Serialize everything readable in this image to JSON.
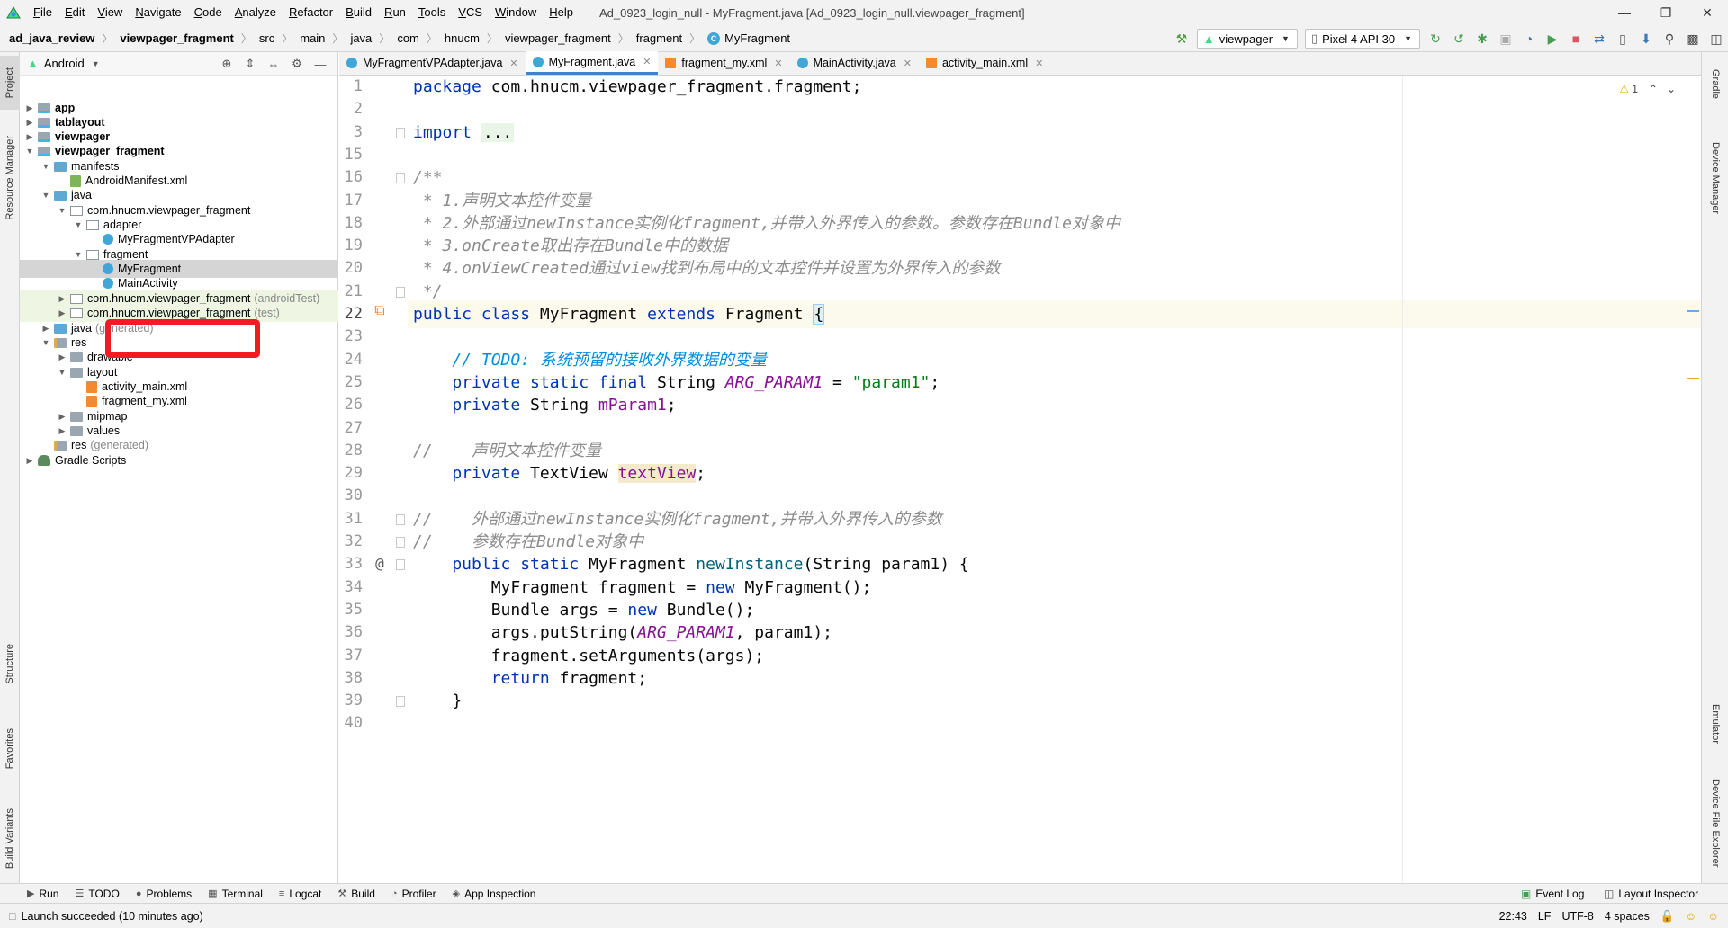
{
  "menubar": {
    "items": [
      "File",
      "Edit",
      "View",
      "Navigate",
      "Code",
      "Analyze",
      "Refactor",
      "Build",
      "Run",
      "Tools",
      "VCS",
      "Window",
      "Help"
    ],
    "window_title": "Ad_0923_login_null - MyFragment.java [Ad_0923_login_null.viewpager_fragment]"
  },
  "breadcrumb": [
    "ad_java_review",
    "viewpager_fragment",
    "src",
    "main",
    "java",
    "com",
    "hnucm",
    "viewpager_fragment",
    "fragment",
    "MyFragment"
  ],
  "toolbar": {
    "run_config": "viewpager",
    "device": "Pixel 4 API 30"
  },
  "left_stripe": [
    "Project",
    "Resource Manager",
    "Structure",
    "Favorites",
    "Build Variants"
  ],
  "right_stripe": [
    "Gradle",
    "Device Manager",
    "Emulator",
    "Device File Explorer"
  ],
  "project_panel": {
    "view_mode": "Android",
    "tree": [
      {
        "label": "app",
        "bold": true,
        "icon": "module",
        "arrow": "▶",
        "hint": ""
      },
      {
        "label": "tablayout",
        "bold": true,
        "icon": "module",
        "arrow": "▶",
        "hint": ""
      },
      {
        "label": "viewpager",
        "bold": true,
        "icon": "module",
        "arrow": "▶",
        "hint": ""
      },
      {
        "label": "viewpager_fragment",
        "bold": true,
        "icon": "module",
        "arrow": "▼",
        "hint": ""
      },
      {
        "label": "manifests",
        "bold": false,
        "icon": "src",
        "arrow": "▼",
        "hint": ""
      },
      {
        "label": "AndroidManifest.xml",
        "bold": false,
        "icon": "manifest",
        "arrow": "",
        "hint": ""
      },
      {
        "label": "java",
        "bold": false,
        "icon": "src",
        "arrow": "▼",
        "hint": ""
      },
      {
        "label": "com.hnucm.viewpager_fragment",
        "bold": false,
        "icon": "pkg",
        "arrow": "▼",
        "hint": ""
      },
      {
        "label": "adapter",
        "bold": false,
        "icon": "pkg",
        "arrow": "▼",
        "hint": ""
      },
      {
        "label": "MyFragmentVPAdapter",
        "bold": false,
        "icon": "cls",
        "arrow": "",
        "hint": ""
      },
      {
        "label": "fragment",
        "bold": false,
        "icon": "pkg",
        "arrow": "▼",
        "hint": ""
      },
      {
        "label": "MyFragment",
        "bold": false,
        "icon": "cls",
        "arrow": "",
        "hint": ""
      },
      {
        "label": "MainActivity",
        "bold": false,
        "icon": "cls",
        "arrow": "",
        "hint": ""
      },
      {
        "label": "com.hnucm.viewpager_fragment",
        "bold": false,
        "icon": "pkg",
        "arrow": "▶",
        "hint": "(androidTest)"
      },
      {
        "label": "com.hnucm.viewpager_fragment",
        "bold": false,
        "icon": "pkg",
        "arrow": "▶",
        "hint": "(test)"
      },
      {
        "label": "java",
        "bold": false,
        "icon": "src",
        "arrow": "▶",
        "hint": "(generated)"
      },
      {
        "label": "res",
        "bold": false,
        "icon": "res",
        "arrow": "▼",
        "hint": ""
      },
      {
        "label": "drawable",
        "bold": false,
        "icon": "folder",
        "arrow": "▶",
        "hint": ""
      },
      {
        "label": "layout",
        "bold": false,
        "icon": "folder",
        "arrow": "▼",
        "hint": ""
      },
      {
        "label": "activity_main.xml",
        "bold": false,
        "icon": "xml",
        "arrow": "",
        "hint": ""
      },
      {
        "label": "fragment_my.xml",
        "bold": false,
        "icon": "xml",
        "arrow": "",
        "hint": ""
      },
      {
        "label": "mipmap",
        "bold": false,
        "icon": "folder",
        "arrow": "▶",
        "hint": ""
      },
      {
        "label": "values",
        "bold": false,
        "icon": "folder",
        "arrow": "▶",
        "hint": ""
      },
      {
        "label": "res",
        "bold": false,
        "icon": "res",
        "arrow": "",
        "hint": "(generated)"
      },
      {
        "label": "Gradle Scripts",
        "bold": false,
        "icon": "gradle",
        "arrow": "▶",
        "hint": ""
      }
    ]
  },
  "editor": {
    "tabs": [
      {
        "label": "MyFragmentVPAdapter.java",
        "type": "java",
        "active": false
      },
      {
        "label": "MyFragment.java",
        "type": "java",
        "active": true
      },
      {
        "label": "fragment_my.xml",
        "type": "xml",
        "active": false
      },
      {
        "label": "MainActivity.java",
        "type": "java",
        "active": false
      },
      {
        "label": "activity_main.xml",
        "type": "xml",
        "active": false
      }
    ],
    "warning_count": "1",
    "line_numbers": [
      "1",
      "2",
      "3",
      "15",
      "16",
      "17",
      "18",
      "19",
      "20",
      "21",
      "22",
      "23",
      "24",
      "25",
      "26",
      "27",
      "28",
      "29",
      "30",
      "31",
      "32",
      "33",
      "34",
      "35",
      "36",
      "37",
      "38",
      "39",
      "40"
    ],
    "code_lines": [
      [
        {
          "t": "package ",
          "c": "kw"
        },
        {
          "t": "com.hnucm.viewpager_fragment.fragment;",
          "c": ""
        }
      ],
      [],
      [
        {
          "t": "import ",
          "c": "kw"
        },
        {
          "t": "...",
          "c": "fold-text"
        }
      ],
      [],
      [
        {
          "t": "/**",
          "c": "cm"
        }
      ],
      [
        {
          "t": " * 1.声明文本控件变量",
          "c": "cm"
        }
      ],
      [
        {
          "t": " * 2.外部通过newInstance实例化fragment,并带入外界传入的参数。参数存在Bundle对象中",
          "c": "cm"
        }
      ],
      [
        {
          "t": " * 3.onCreate取出存在Bundle中的数据",
          "c": "cm"
        }
      ],
      [
        {
          "t": " * 4.onViewCreated通过view找到布局中的文本控件并设置为外界传入的参数",
          "c": "cm"
        }
      ],
      [
        {
          "t": " */",
          "c": "cm"
        }
      ],
      [
        {
          "t": "public class ",
          "c": "kw"
        },
        {
          "t": "MyFragment ",
          "c": ""
        },
        {
          "t": "extends ",
          "c": "kw"
        },
        {
          "t": "Fragment ",
          "c": ""
        },
        {
          "t": "{",
          "c": "brace-hl"
        }
      ],
      [],
      [
        {
          "t": "    // TODO: 系统预留的接收外界数据的变量",
          "c": "todo"
        }
      ],
      [
        {
          "t": "    private static final ",
          "c": "kw"
        },
        {
          "t": "String ",
          "c": ""
        },
        {
          "t": "ARG_PARAM1",
          "c": "cst"
        },
        {
          "t": " = ",
          "c": ""
        },
        {
          "t": "\"param1\"",
          "c": "st"
        },
        {
          "t": ";",
          "c": ""
        }
      ],
      [
        {
          "t": "    private ",
          "c": "kw"
        },
        {
          "t": "String ",
          "c": ""
        },
        {
          "t": "mParam1",
          "c": "fld"
        },
        {
          "t": ";",
          "c": ""
        }
      ],
      [],
      [
        {
          "t": "//    声明文本控件变量",
          "c": "cm"
        }
      ],
      [
        {
          "t": "    private ",
          "c": "kw"
        },
        {
          "t": "TextView ",
          "c": ""
        },
        {
          "t": "textView",
          "c": "fld hl-field"
        },
        {
          "t": ";",
          "c": ""
        }
      ],
      [],
      [
        {
          "t": "//    外部通过newInstance实例化fragment,并带入外界传入的参数",
          "c": "cm"
        }
      ],
      [
        {
          "t": "//    参数存在Bundle对象中",
          "c": "cm"
        }
      ],
      [
        {
          "t": "    public static ",
          "c": "kw"
        },
        {
          "t": "MyFragment ",
          "c": ""
        },
        {
          "t": "newInstance",
          "c": "mth"
        },
        {
          "t": "(String param1) {",
          "c": ""
        }
      ],
      [
        {
          "t": "        MyFragment fragment = ",
          "c": ""
        },
        {
          "t": "new ",
          "c": "kw"
        },
        {
          "t": "MyFragment();",
          "c": ""
        }
      ],
      [
        {
          "t": "        Bundle args = ",
          "c": ""
        },
        {
          "t": "new ",
          "c": "kw"
        },
        {
          "t": "Bundle();",
          "c": ""
        }
      ],
      [
        {
          "t": "        args.putString(",
          "c": ""
        },
        {
          "t": "ARG_PARAM1",
          "c": "cst"
        },
        {
          "t": ", param1);",
          "c": ""
        }
      ],
      [
        {
          "t": "        fragment.setArguments(args);",
          "c": ""
        }
      ],
      [
        {
          "t": "        return ",
          "c": "kw"
        },
        {
          "t": "fragment;",
          "c": ""
        }
      ],
      [
        {
          "t": "    }",
          "c": ""
        }
      ],
      []
    ]
  },
  "bottom_tools": {
    "left": [
      "Run",
      "TODO",
      "Problems",
      "Terminal",
      "Logcat",
      "Build",
      "Profiler",
      "App Inspection"
    ],
    "right": [
      "Event Log",
      "Layout Inspector"
    ]
  },
  "statusbar": {
    "message": "Launch succeeded (10 minutes ago)",
    "position": "22:43",
    "line_sep": "LF",
    "encoding": "UTF-8",
    "indent": "4 spaces"
  },
  "colors": {
    "accent": "#4083c9",
    "highlight_box": "#ee1c25",
    "keyword": "#0033b3",
    "comment": "#8c8c8c",
    "string": "#067d17",
    "field": "#871094"
  }
}
